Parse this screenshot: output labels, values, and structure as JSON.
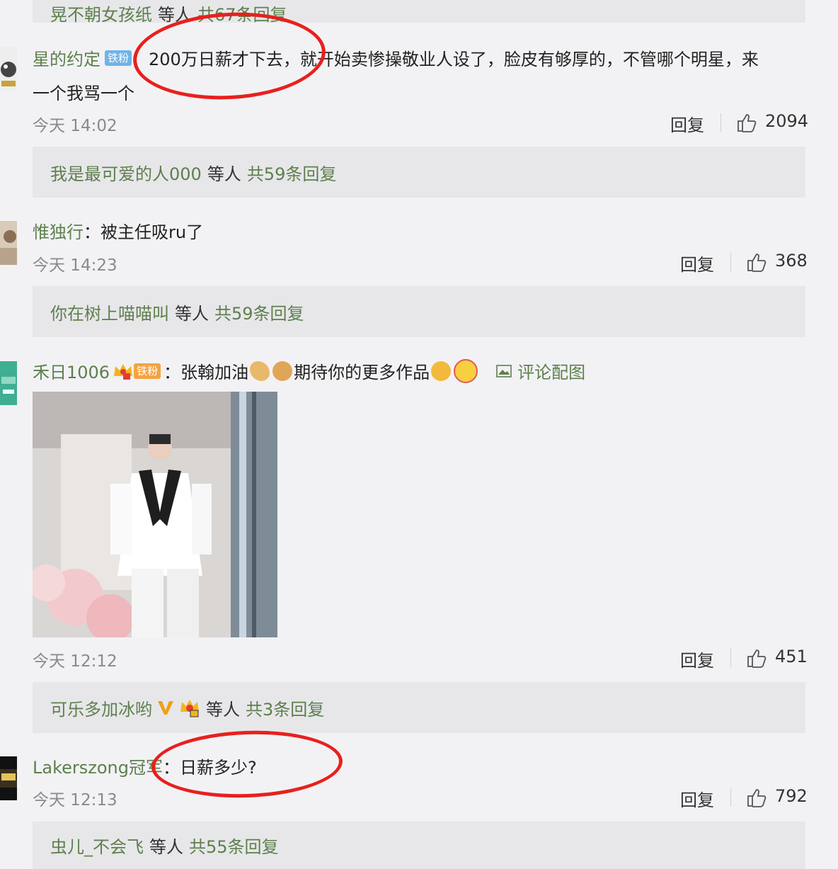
{
  "top_reply": {
    "users": "晃不朝女孩纸",
    "etc": "等人",
    "count": "共67条回复"
  },
  "comments": [
    {
      "username": "星的约定",
      "badge": "铁粉",
      "text_line1": "：200万日薪才下去，就开始卖惨操敬业人设了，脸皮有够厚的，不管哪个明星，来",
      "text_line2": "一个我骂一个",
      "time": "今天 14:02",
      "reply_label": "回复",
      "likes": "2094",
      "replies": {
        "users": "我是最可爱的人000",
        "etc": "等人",
        "count": "共59条回复"
      }
    },
    {
      "username": "惟独行",
      "text_line1": "：被主任吸ru了",
      "time": "今天 14:23",
      "reply_label": "回复",
      "likes": "368",
      "replies": {
        "users": "你在树上喵喵叫",
        "etc": "等人",
        "count": "共59条回复"
      }
    },
    {
      "username": "禾日1006",
      "badge": "铁粉",
      "badge_level": "5",
      "text_line1": "：张翰加油",
      "text_line1b": "期待你的更多作品",
      "pic_link": "评论配图",
      "time": "今天 12:12",
      "reply_label": "回复",
      "likes": "451",
      "replies": {
        "users": "可乐多加冰哟",
        "etc": "等人",
        "count": "共3条回复"
      }
    },
    {
      "username": "Lakerszong冠军",
      "text_line1": "：日薪多少?",
      "time": "今天 12:13",
      "reply_label": "回复",
      "likes": "792",
      "replies": {
        "users": "虫儿_不会飞",
        "etc": "等人",
        "count": "共55条回复"
      }
    }
  ],
  "colors": {
    "link": "#5e7f4c",
    "annotation": "#e8201d",
    "background": "#f2f2f5"
  },
  "icons": [
    "thumbs-up-icon",
    "image-icon",
    "crown-icon",
    "verified-v-icon"
  ]
}
